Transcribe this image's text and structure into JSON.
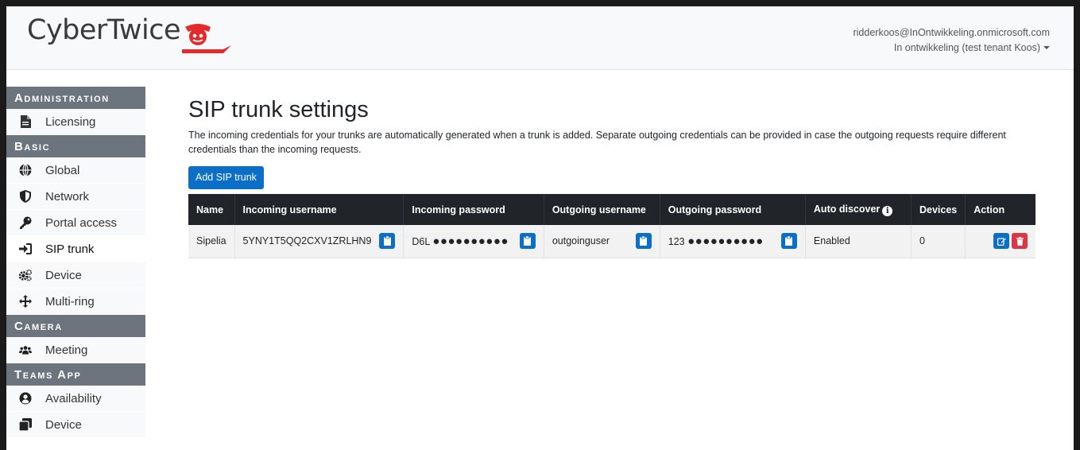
{
  "header": {
    "brand": "CyberTwice",
    "user_email": "ridderkoos@InOntwikkeling.onmicrosoft.com",
    "tenant": "In ontwikkeling (test tenant Koos)"
  },
  "sidebar": {
    "sections": [
      {
        "title": "Administration",
        "items": [
          {
            "label": "Licensing",
            "icon": "file-icon"
          }
        ]
      },
      {
        "title": "Basic",
        "items": [
          {
            "label": "Global",
            "icon": "globe-icon"
          },
          {
            "label": "Network",
            "icon": "shield-icon"
          },
          {
            "label": "Portal access",
            "icon": "key-icon"
          },
          {
            "label": "SIP trunk",
            "icon": "sign-in-icon",
            "active": true
          },
          {
            "label": "Device",
            "icon": "cogs-icon"
          },
          {
            "label": "Multi-ring",
            "icon": "arrows-icon"
          }
        ]
      },
      {
        "title": "Camera",
        "items": [
          {
            "label": "Meeting",
            "icon": "users-icon"
          }
        ]
      },
      {
        "title": "Teams App",
        "items": [
          {
            "label": "Availability",
            "icon": "user-circle-icon"
          },
          {
            "label": "Device",
            "icon": "copy-icon"
          }
        ]
      }
    ]
  },
  "main": {
    "title": "SIP trunk settings",
    "description": "The incoming credentials for your trunks are automatically generated when a trunk is added. Separate outgoing credentials can be provided in case the outgoing requests require different credentials than the incoming requests.",
    "add_button": "Add SIP trunk",
    "table": {
      "headers": [
        "Name",
        "Incoming username",
        "Incoming password",
        "Outgoing username",
        "Outgoing password",
        "Auto discover",
        "Devices",
        "Action"
      ],
      "rows": [
        {
          "name": "Sipelia",
          "incoming_username": "5YNY1T5QQ2CXV1ZRLHN9",
          "incoming_password_prefix": "D6L",
          "incoming_password_mask": "●●●●●●●●●●",
          "outgoing_username": "outgoinguser",
          "outgoing_password_prefix": "123",
          "outgoing_password_mask": "●●●●●●●●●●",
          "auto_discover": "Enabled",
          "devices": "0"
        }
      ]
    }
  },
  "colors": {
    "primary": "#0b6fc8",
    "danger": "#dc3545",
    "section_bg": "#6c757d",
    "table_head": "#212529",
    "logo_red": "#e32b2b"
  }
}
